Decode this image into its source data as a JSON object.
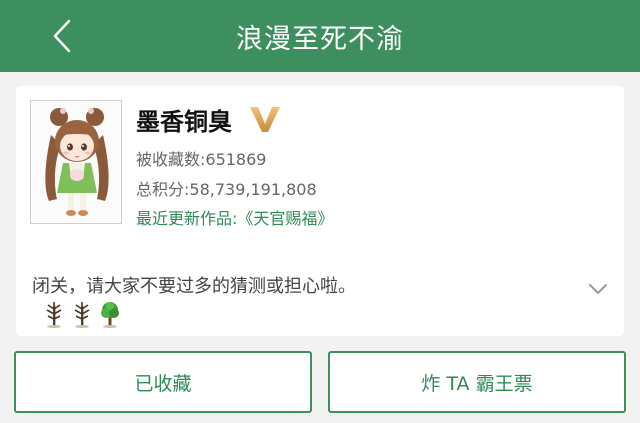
{
  "header": {
    "title": "浪漫至死不渝"
  },
  "author": {
    "name": "墨香铜臭",
    "favorites_label": "被收藏数:651869",
    "score_label": "总积分:58,739,191,808",
    "latest_work_label": "最近更新作品:《天官赐福》",
    "bio": "闭关，请大家不要过多的猜测或担心啦。"
  },
  "actions": {
    "collected_label": "已收藏",
    "bomb_label": "炸 TA 霸王票"
  },
  "colors": {
    "brand_green": "#3d8f5f",
    "link_green": "#2f8a55",
    "vip_gold": "#d9a24a"
  },
  "icons": {
    "back": "chevron-left-icon",
    "vip": "v-badge-icon",
    "expand": "chevron-down-icon",
    "trees": [
      "bare-tree-icon",
      "bare-tree-icon",
      "leafy-tree-icon"
    ]
  }
}
